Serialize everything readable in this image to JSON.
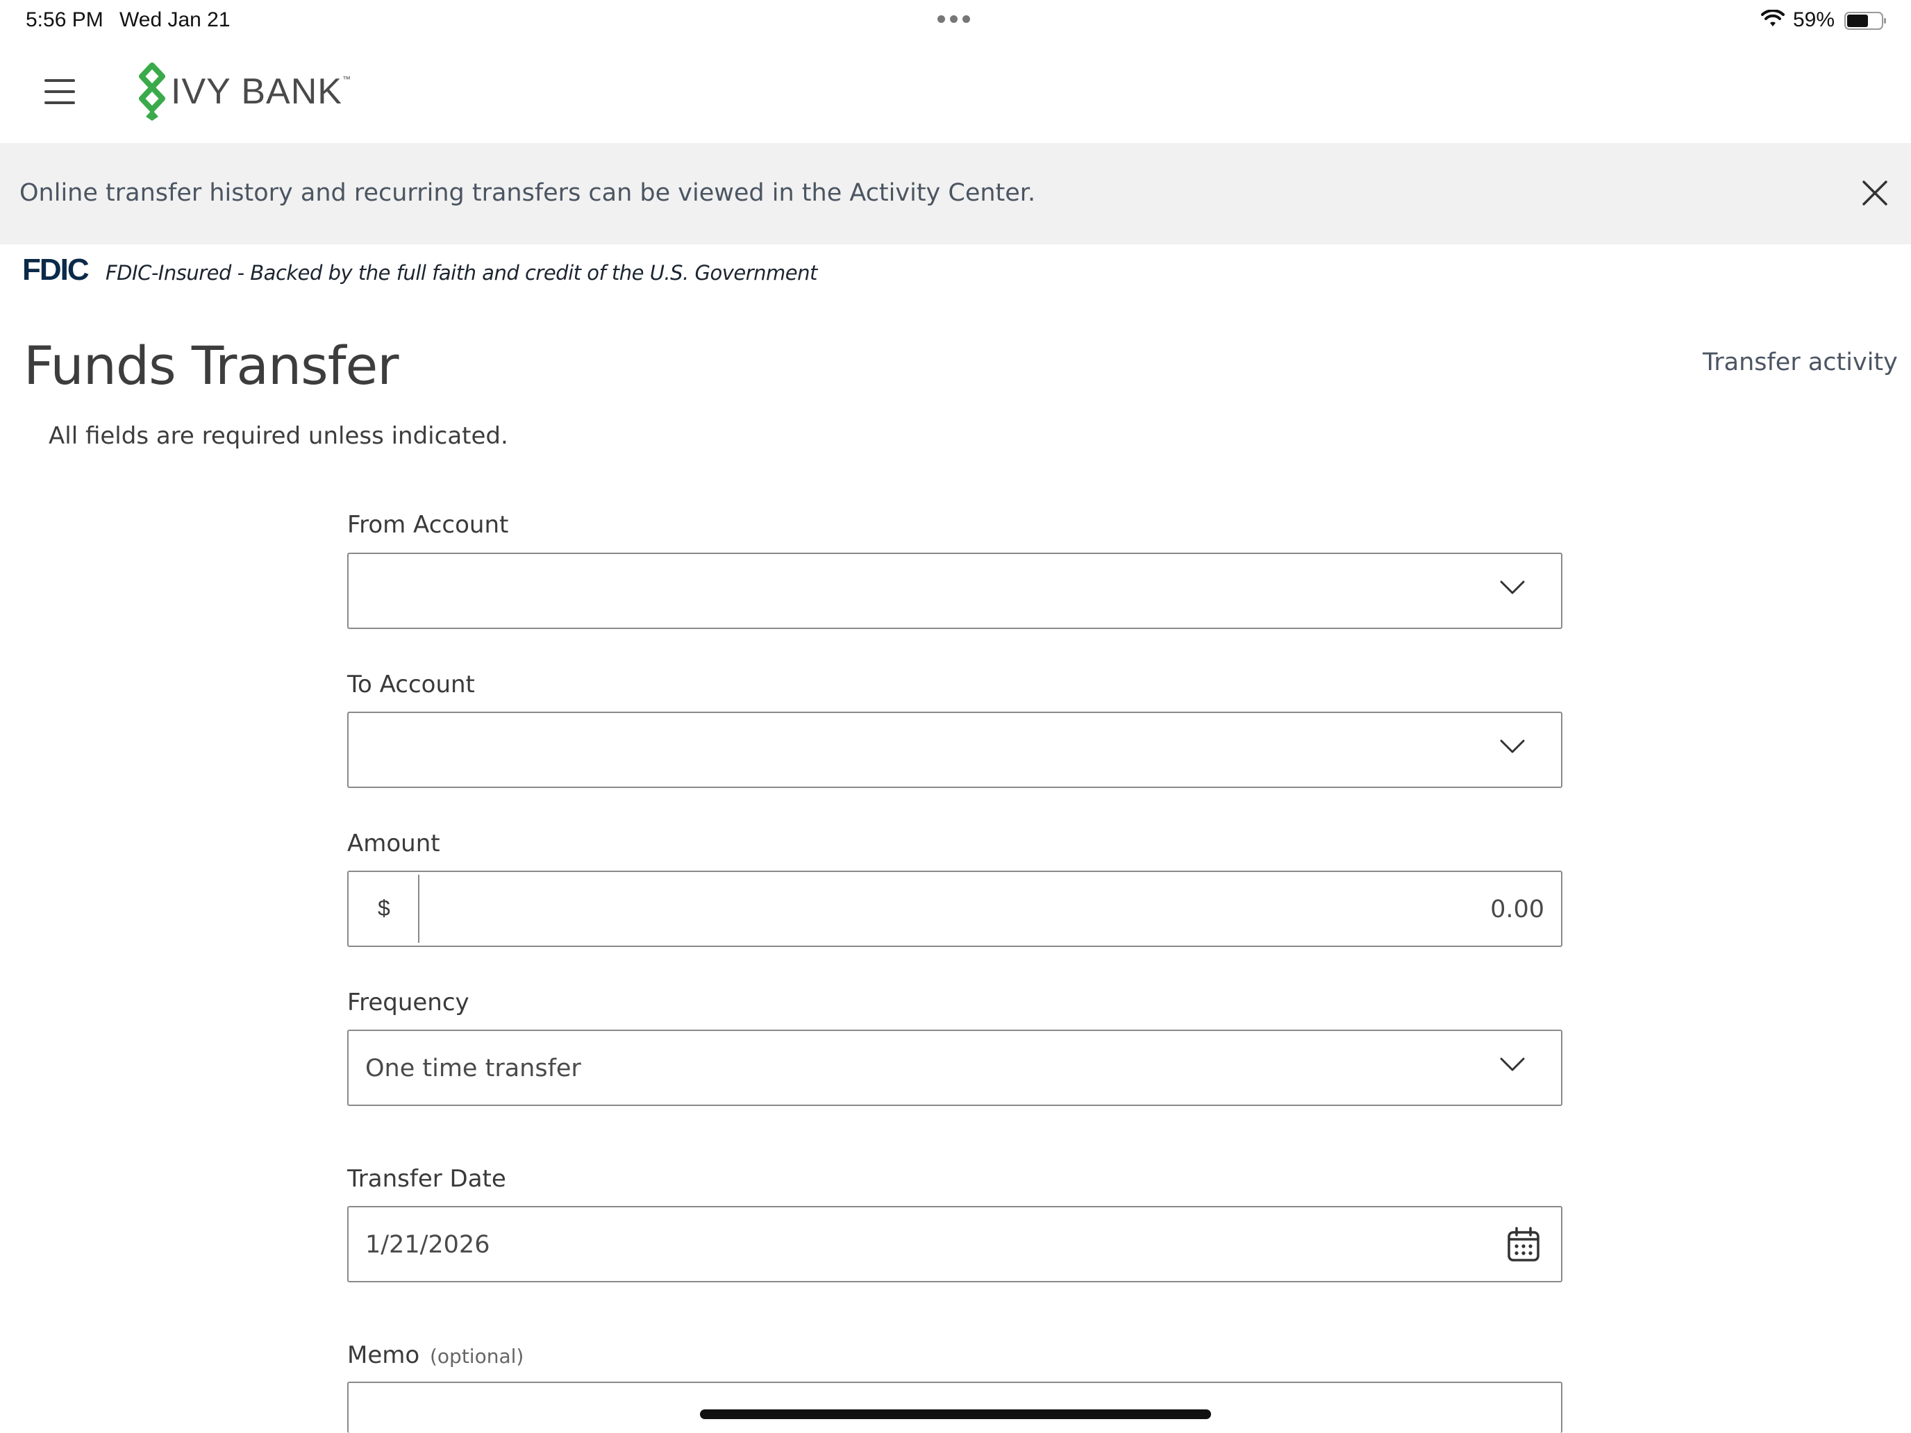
{
  "status_bar": {
    "time": "5:56 PM",
    "date": "Wed Jan 21",
    "battery": "59%"
  },
  "header": {
    "logo_text": "IVY BANK",
    "logo_tm": "™",
    "logo_color": "#3aaa4a"
  },
  "banner": {
    "text": "Online transfer history and recurring transfers can be viewed in the Activity Center."
  },
  "fdic": {
    "logo": "FDIC",
    "text": "FDIC-Insured - Backed by the full faith and credit of the U.S. Government"
  },
  "page": {
    "title": "Funds Transfer",
    "transfer_activity_link": "Transfer activity",
    "required_note": "All fields are required unless indicated."
  },
  "form": {
    "from_account": {
      "label": "From Account",
      "value": ""
    },
    "to_account": {
      "label": "To Account",
      "value": ""
    },
    "amount": {
      "label": "Amount",
      "prefix": "$",
      "placeholder": "0.00"
    },
    "frequency": {
      "label": "Frequency",
      "value": "One time transfer"
    },
    "transfer_date": {
      "label": "Transfer Date",
      "value": "1/21/2026"
    },
    "memo": {
      "label": "Memo",
      "optional": "(optional)",
      "value": ""
    }
  }
}
